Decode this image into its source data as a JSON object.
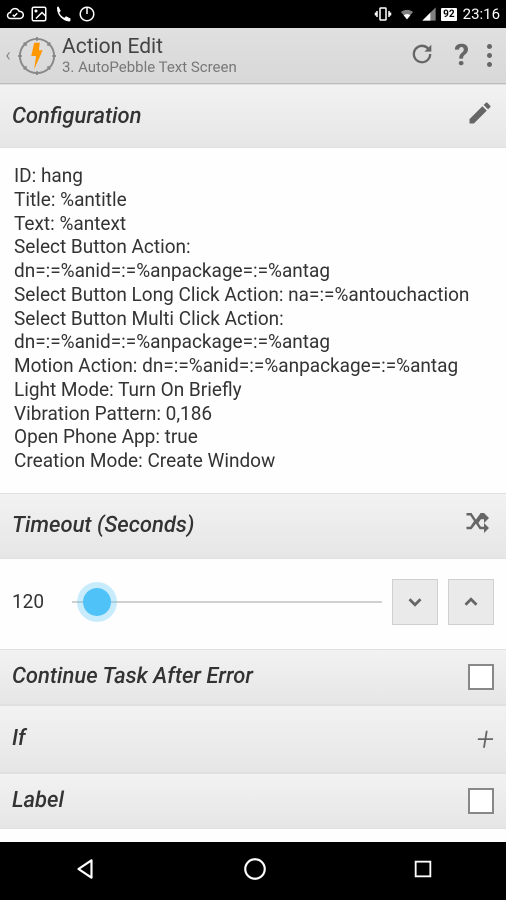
{
  "status": {
    "time": "23:16",
    "battery": "92"
  },
  "appbar": {
    "title": "Action Edit",
    "subtitle": "3. AutoPebble Text Screen"
  },
  "sections": {
    "configuration": {
      "title": "Configuration",
      "body": "ID: hang\nTitle: %antitle\nText: %antext\nSelect Button Action: dn=:=%anid=:=%anpackage=:=%antag\nSelect Button Long Click Action: na=:=%antouchaction\nSelect Button Multi Click Action: dn=:=%anid=:=%anpackage=:=%antag\nMotion Action: dn=:=%anid=:=%anpackage=:=%antag\nLight Mode: Turn On Briefly\nVibration Pattern: 0,186\nOpen Phone App: true\nCreation Mode: Create Window"
    },
    "timeout": {
      "title": "Timeout (Seconds)",
      "value": "120"
    },
    "continue_after_error": {
      "title": "Continue Task After Error"
    },
    "if": {
      "title": "If"
    },
    "label": {
      "title": "Label"
    }
  }
}
